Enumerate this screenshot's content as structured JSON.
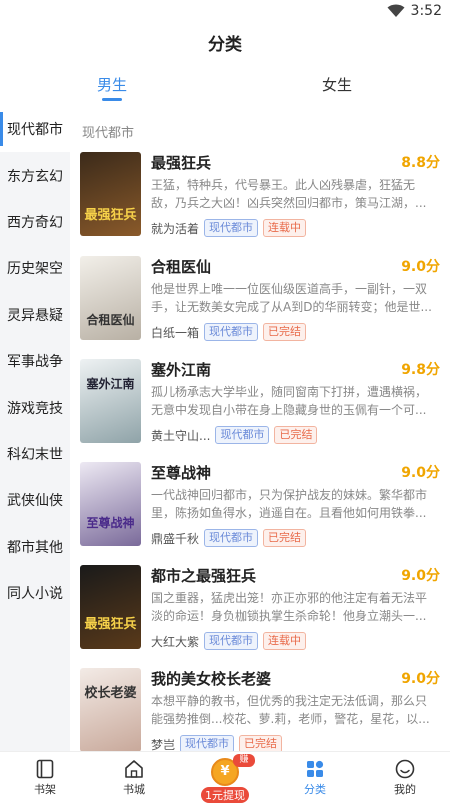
{
  "status_bar": {
    "time": "3:52",
    "wifi_icon": "wifi-icon"
  },
  "header": {
    "title": "分类"
  },
  "gender_tabs": [
    {
      "label": "男生",
      "active": true
    },
    {
      "label": "女生",
      "active": false
    }
  ],
  "sidebar": {
    "items": [
      {
        "label": "现代都市",
        "active": true
      },
      {
        "label": "东方玄幻"
      },
      {
        "label": "西方奇幻"
      },
      {
        "label": "历史架空"
      },
      {
        "label": "灵异悬疑"
      },
      {
        "label": "军事战争"
      },
      {
        "label": "游戏竞技"
      },
      {
        "label": "科幻末世"
      },
      {
        "label": "武侠仙侠"
      },
      {
        "label": "都市其他"
      },
      {
        "label": "同人小说"
      }
    ]
  },
  "content": {
    "section_title": "现代都市",
    "books": [
      {
        "title": "最强狂兵",
        "score": "8.8分",
        "desc": "王猛，特种兵，代号暴王。此人凶残暴虐，狂猛无敌，乃兵之大凶！凶兵突然回归都市，策马江湖，...",
        "author": "就为活着",
        "category": "现代都市",
        "status": "连载中",
        "cover_text": "最强狂兵",
        "cover_colors": [
          "#3b2a1a",
          "#8a5a2a"
        ]
      },
      {
        "title": "合租医仙",
        "score": "9.0分",
        "desc": "他是世界上唯一一位医仙级医道高手，一副针，一双手，让无数美女完成了从A到D的华丽转变；他是世...",
        "author": "白纸一箱",
        "category": "现代都市",
        "status": "已完结",
        "cover_text": "合租医仙",
        "cover_colors": [
          "#e8e4dc",
          "#b8b0a4"
        ]
      },
      {
        "title": "塞外江南",
        "score": "9.8分",
        "desc": "孤儿杨承志大学毕业，随同窗南下打拼，遭遇横祸，无意中发现自小带在身上隐藏身世的玉佩有一个可...",
        "author": "黄土守山...",
        "category": "现代都市",
        "status": "已完结",
        "cover_text": "塞外江南",
        "cover_colors": [
          "#dfe6e8",
          "#8fa3a8"
        ]
      },
      {
        "title": "至尊战神",
        "score": "9.0分",
        "desc": "一代战神回归都市，只为保护战友的妹妹。繁华都市里，陈扬如鱼得水，逍遥自在。且看他如何用铁拳...",
        "author": "鼎盛千秋",
        "category": "现代都市",
        "status": "已完结",
        "cover_text": "至尊战神",
        "cover_colors": [
          "#e6e2ee",
          "#7a6a9a"
        ]
      },
      {
        "title": "都市之最强狂兵",
        "score": "9.0分",
        "desc": "国之重器，猛虎出笼！亦正亦邪的他注定有着无法平淡的命运！身负枷锁执掌生杀命轮！他身立潮头一...",
        "author": "大红大紫",
        "category": "现代都市",
        "status": "连载中",
        "cover_text": "最强狂兵",
        "cover_colors": [
          "#1a1a1a",
          "#5a3a1a"
        ]
      },
      {
        "title": "我的美女校长老婆",
        "score": "9.0分",
        "desc": "本想平静的教书，但优秀的我注定无法低调，那么只能强势推倒...校花、萝.莉，老师，警花，星花，以...",
        "author": "梦岂",
        "category": "现代都市",
        "status": "已完结",
        "cover_text": "校长老婆",
        "cover_colors": [
          "#f0e6e0",
          "#c8a89a"
        ]
      }
    ]
  },
  "bottom_nav": {
    "items": [
      {
        "label": "书架",
        "icon": "bookshelf-icon"
      },
      {
        "label": "书城",
        "icon": "home-icon"
      },
      {
        "label": "1元提现",
        "icon": "coin-icon",
        "badge": "赚钱"
      },
      {
        "label": "分类",
        "icon": "category-icon",
        "active": true
      },
      {
        "label": "我的",
        "icon": "smile-icon"
      }
    ]
  },
  "colors": {
    "accent": "#3a8be8",
    "score": "#f0a500",
    "sidebar_bg": "#f4f5f7"
  }
}
